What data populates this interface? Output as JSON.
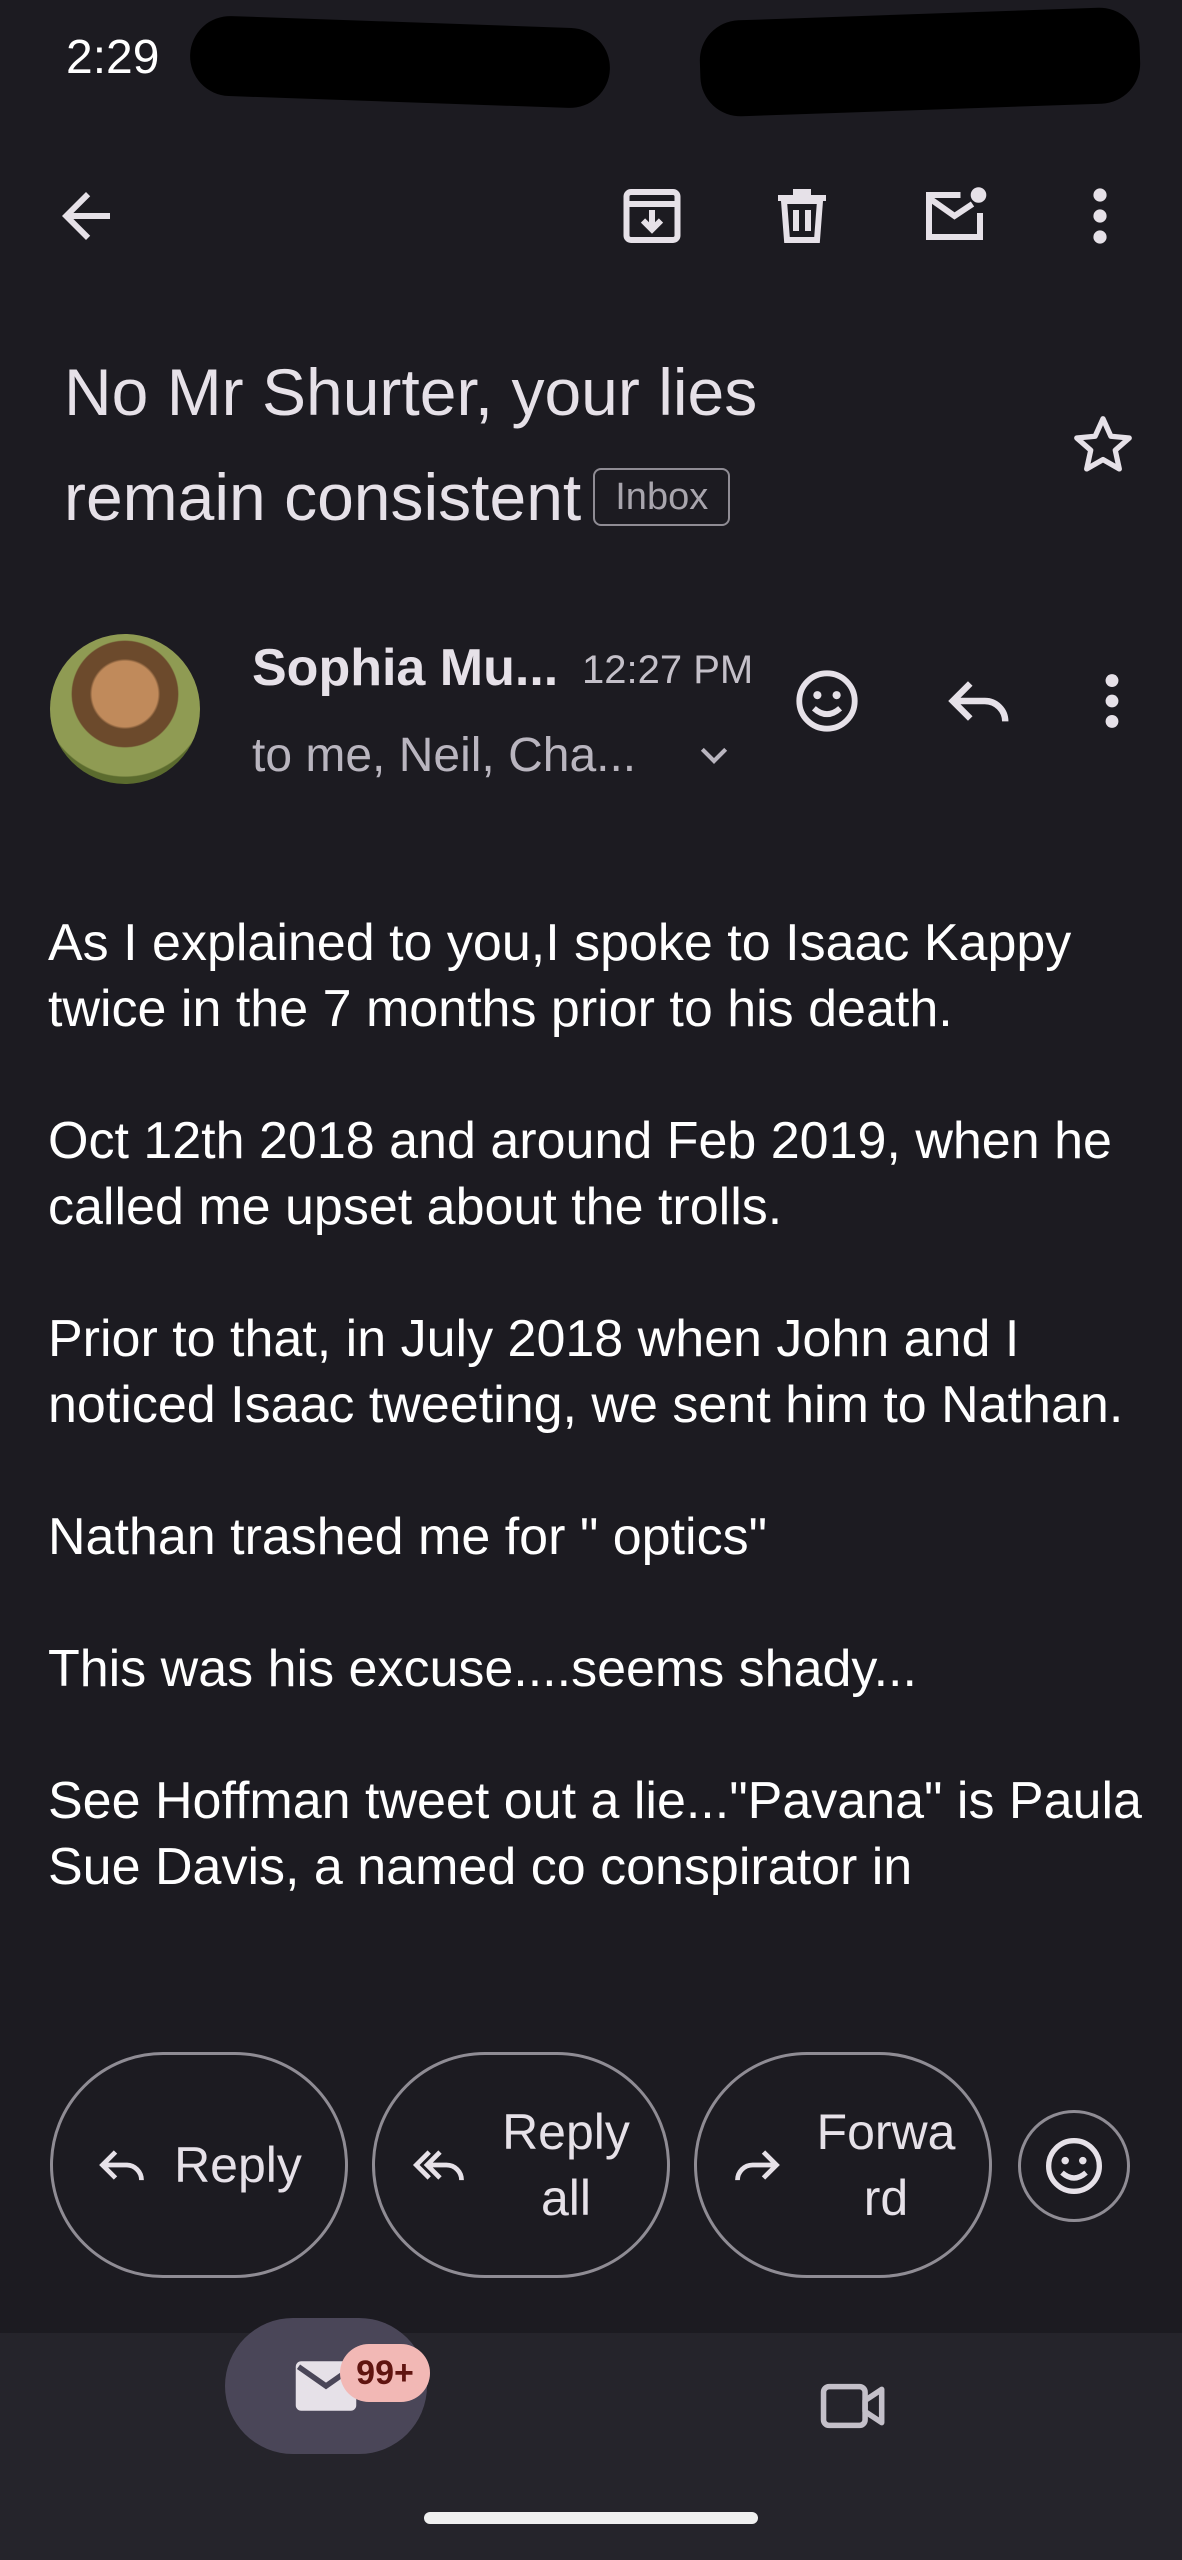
{
  "status_bar": {
    "time": "2:29"
  },
  "toolbar": {
    "back_icon": "arrow-back-icon",
    "archive_icon": "archive-icon",
    "delete_icon": "delete-icon",
    "mark_unread_icon": "mark-unread-icon",
    "more_icon": "more-vert-icon"
  },
  "email": {
    "subject_line1": "No Mr Shurter, your lies",
    "subject_line2": "remain consistent",
    "label": "Inbox",
    "sender": "Sophia Mu...",
    "time": "12:27 PM",
    "recipients": "to me, Neil, Cha...",
    "body": [
      "As I explained to you,I spoke to Isaac Kappy twice in the 7 months prior to his death.",
      "Oct 12th 2018 and around Feb 2019, when he called me upset about the trolls.",
      "Prior to that, in July 2018 when John and I noticed Isaac tweeting, we sent him to Nathan.",
      "Nathan trashed me for \" optics\"",
      "This was his excuse....seems shady...",
      "See Hoffman tweet out a lie...\"Pavana\" is Paula Sue Davis, a named co conspirator in"
    ]
  },
  "actions": {
    "reply": "Reply",
    "reply_all_1": "Reply",
    "reply_all_2": "all",
    "forward_1": "Forwa",
    "forward_2": "rd"
  },
  "bottom_nav": {
    "mail_badge": "99+"
  },
  "colors": {
    "background": "#1c1b21",
    "nav_background": "#25242b",
    "selected_pill": "#4a4658",
    "badge": "#f2b8b5"
  }
}
